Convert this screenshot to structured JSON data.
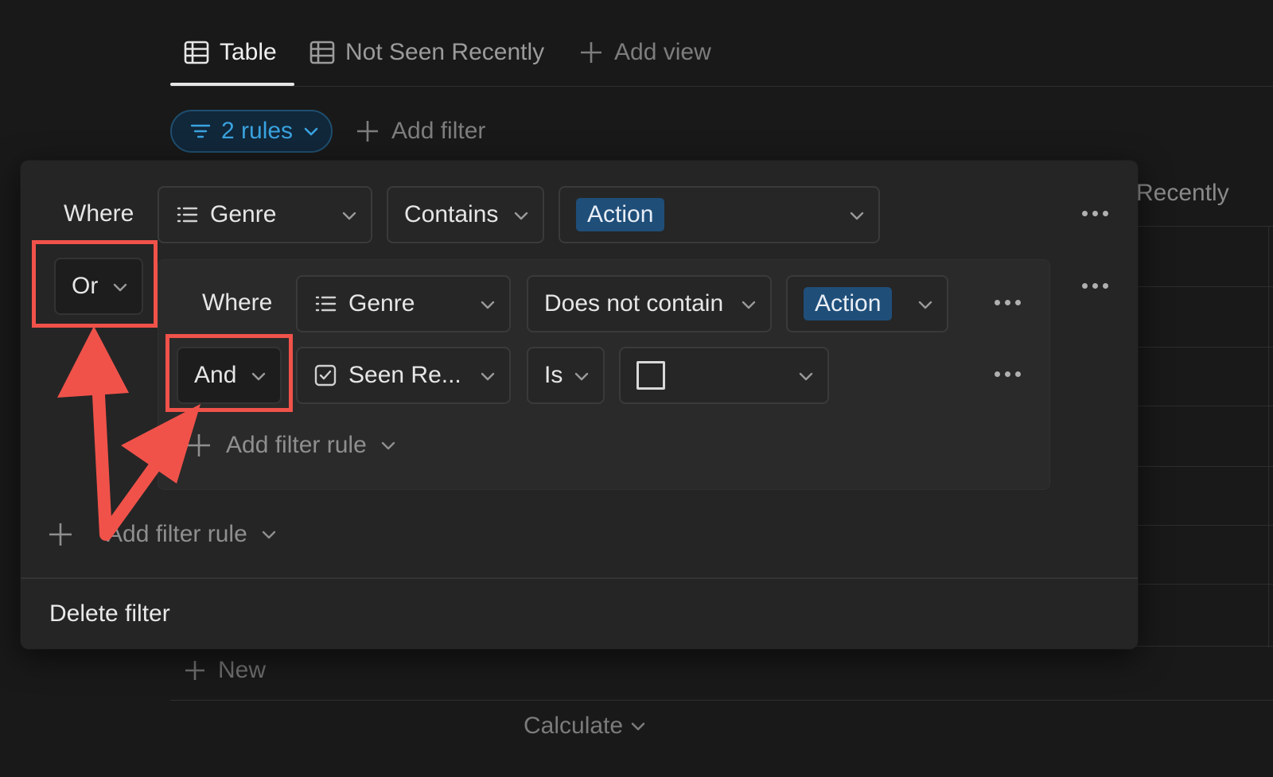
{
  "tabs": [
    {
      "label": "Table",
      "icon": "table-icon",
      "active": true
    },
    {
      "label": "Not Seen Recently",
      "icon": "table-icon",
      "active": false
    }
  ],
  "add_view_label": "Add view",
  "filter_bar": {
    "rules_label": "2 rules",
    "add_filter_label": "Add filter"
  },
  "background_table": {
    "column_header": "Recently",
    "new_label": "New",
    "calculate_label": "Calculate"
  },
  "filter_popup": {
    "rule1": {
      "prefix": "Where",
      "property": "Genre",
      "property_icon": "list-icon",
      "operator": "Contains",
      "value_tag": "Action"
    },
    "group_conjunction": "Or",
    "group": {
      "rule1": {
        "prefix": "Where",
        "property": "Genre",
        "property_icon": "list-icon",
        "operator": "Does not contain",
        "value_tag": "Action"
      },
      "rule2": {
        "conjunction": "And",
        "property": "Seen Re...",
        "property_icon": "checkbox-property-icon",
        "operator": "Is",
        "value": "unchecked"
      },
      "add_rule_label": "Add filter rule"
    },
    "add_rule_label": "Add filter rule",
    "delete_label": "Delete filter"
  },
  "annotation_color": "#f0524a",
  "accent_color": "#3aa3df",
  "tag_color": "#1f4e79"
}
